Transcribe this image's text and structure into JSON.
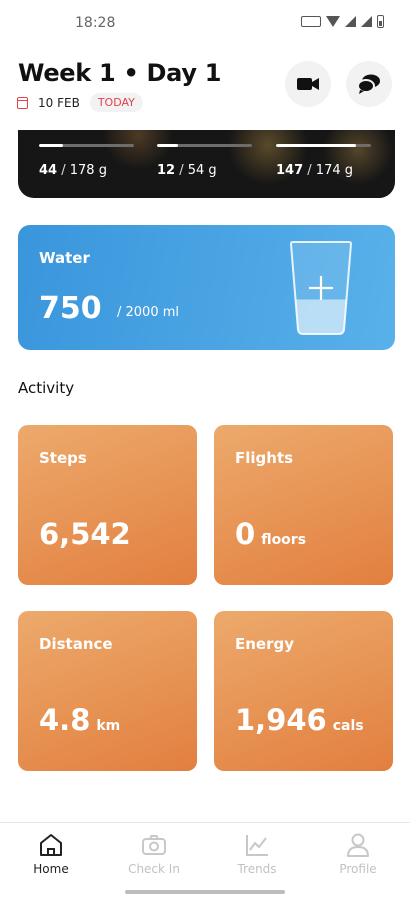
{
  "status_bar": {
    "time": "18:28"
  },
  "header": {
    "title": "Week 1 • Day 1",
    "date": "10 FEB",
    "today_badge": "TODAY"
  },
  "macros": [
    {
      "consumed": "44",
      "goal": "178 g",
      "progress": 0.25
    },
    {
      "consumed": "12",
      "goal": "54 g",
      "progress": 0.22
    },
    {
      "consumed": "147",
      "goal": "174 g",
      "progress": 0.84
    }
  ],
  "water": {
    "label": "Water",
    "amount": "750",
    "goal": "/ 2000 ml",
    "fill_fraction": 0.375
  },
  "activity": {
    "title": "Activity",
    "steps": {
      "label": "Steps",
      "value": "6,542",
      "unit": ""
    },
    "flights": {
      "label": "Flights",
      "value": "0",
      "unit": "floors"
    },
    "distance": {
      "label": "Distance",
      "value": "4.8",
      "unit": "km"
    },
    "energy": {
      "label": "Energy",
      "value": "1,946",
      "unit": "cals"
    }
  },
  "nav": {
    "home": "Home",
    "checkin": "Check In",
    "trends": "Trends",
    "profile": "Profile"
  },
  "colors": {
    "accent_red": "#e0424e",
    "water_blue": "#3a95dc",
    "activity_orange": "#e27f3f"
  },
  "icons": {
    "video": "video-camera-icon",
    "chat": "chat-bubbles-icon",
    "calendar": "calendar-icon",
    "add": "plus-icon",
    "glass": "water-glass-icon",
    "home": "home-icon",
    "checkin": "camera-icon",
    "trends": "chart-line-icon",
    "profile": "person-icon"
  }
}
